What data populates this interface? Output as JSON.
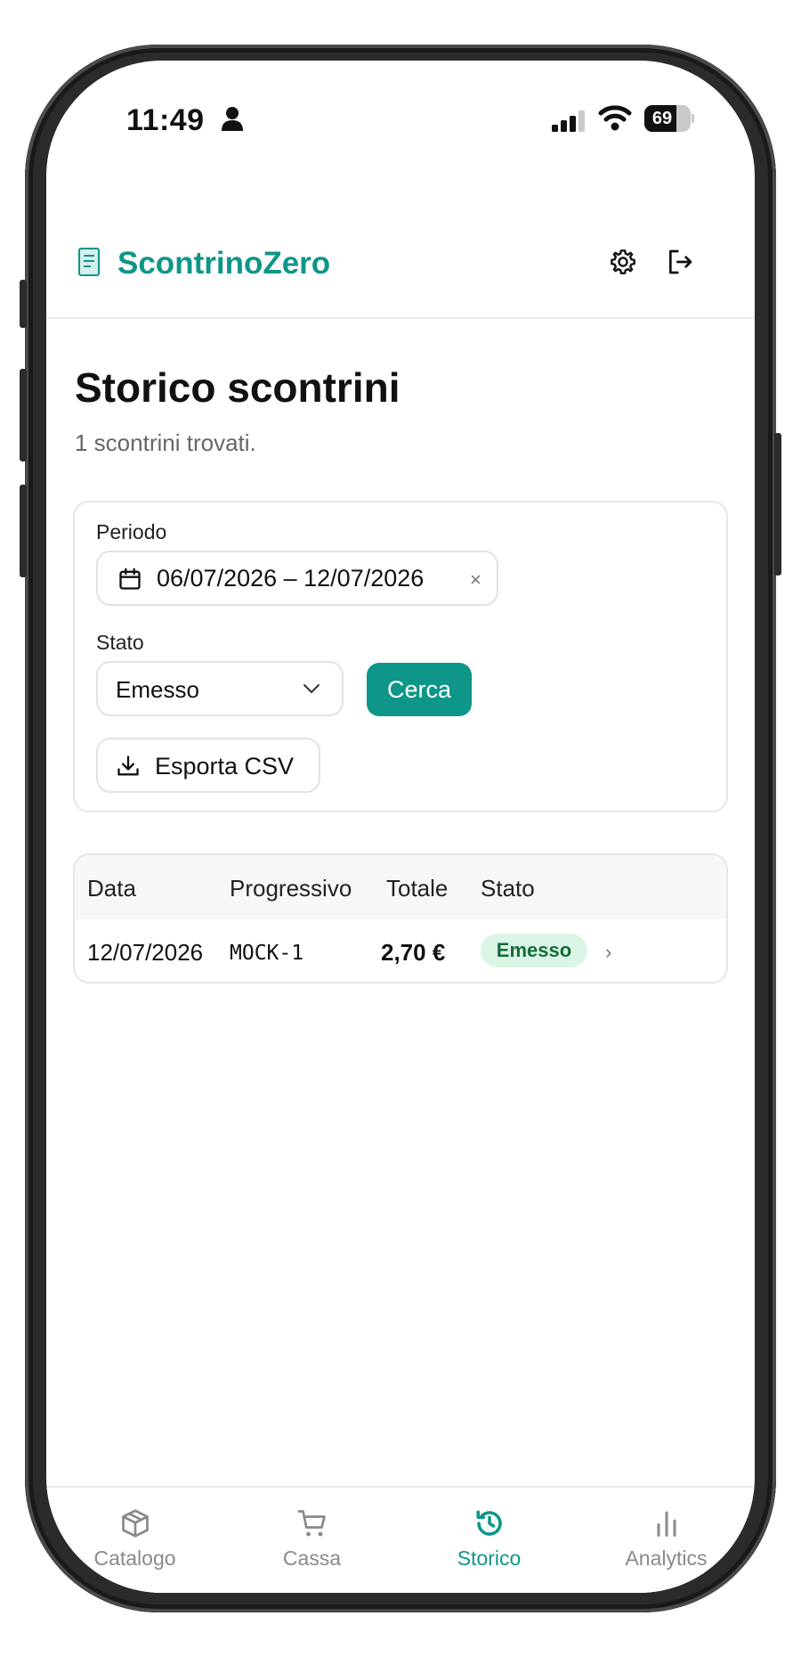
{
  "status_bar": {
    "time": "11:49",
    "battery": "69",
    "battery_level": 0.69
  },
  "header": {
    "app_title": "ScontrinoZero"
  },
  "page": {
    "title": "Storico scontrini",
    "subtitle": "1 scontrini trovati."
  },
  "filters": {
    "period_label": "Periodo",
    "period_value": "06/07/2026 – 12/07/2026",
    "clear_symbol": "×",
    "status_label": "Stato",
    "status_value": "Emesso",
    "search_label": "Cerca",
    "export_label": "Esporta CSV"
  },
  "table": {
    "headers": [
      "Data",
      "Progressivo",
      "Totale",
      "Stato"
    ],
    "rows": [
      {
        "data": "12/07/2026",
        "progressivo": "MOCK-1",
        "totale": "2,70 €",
        "stato": "Emesso"
      }
    ]
  },
  "nav": {
    "items": [
      {
        "label": "Catalogo",
        "icon": "box-icon",
        "active": false
      },
      {
        "label": "Cassa",
        "icon": "cart-icon",
        "active": false
      },
      {
        "label": "Storico",
        "icon": "history-icon",
        "active": true
      },
      {
        "label": "Analytics",
        "icon": "bar-chart-icon",
        "active": false
      }
    ]
  },
  "colors": {
    "accent": "#0e9688",
    "badge_bg": "#daf5e4",
    "badge_text": "#146c3a"
  }
}
